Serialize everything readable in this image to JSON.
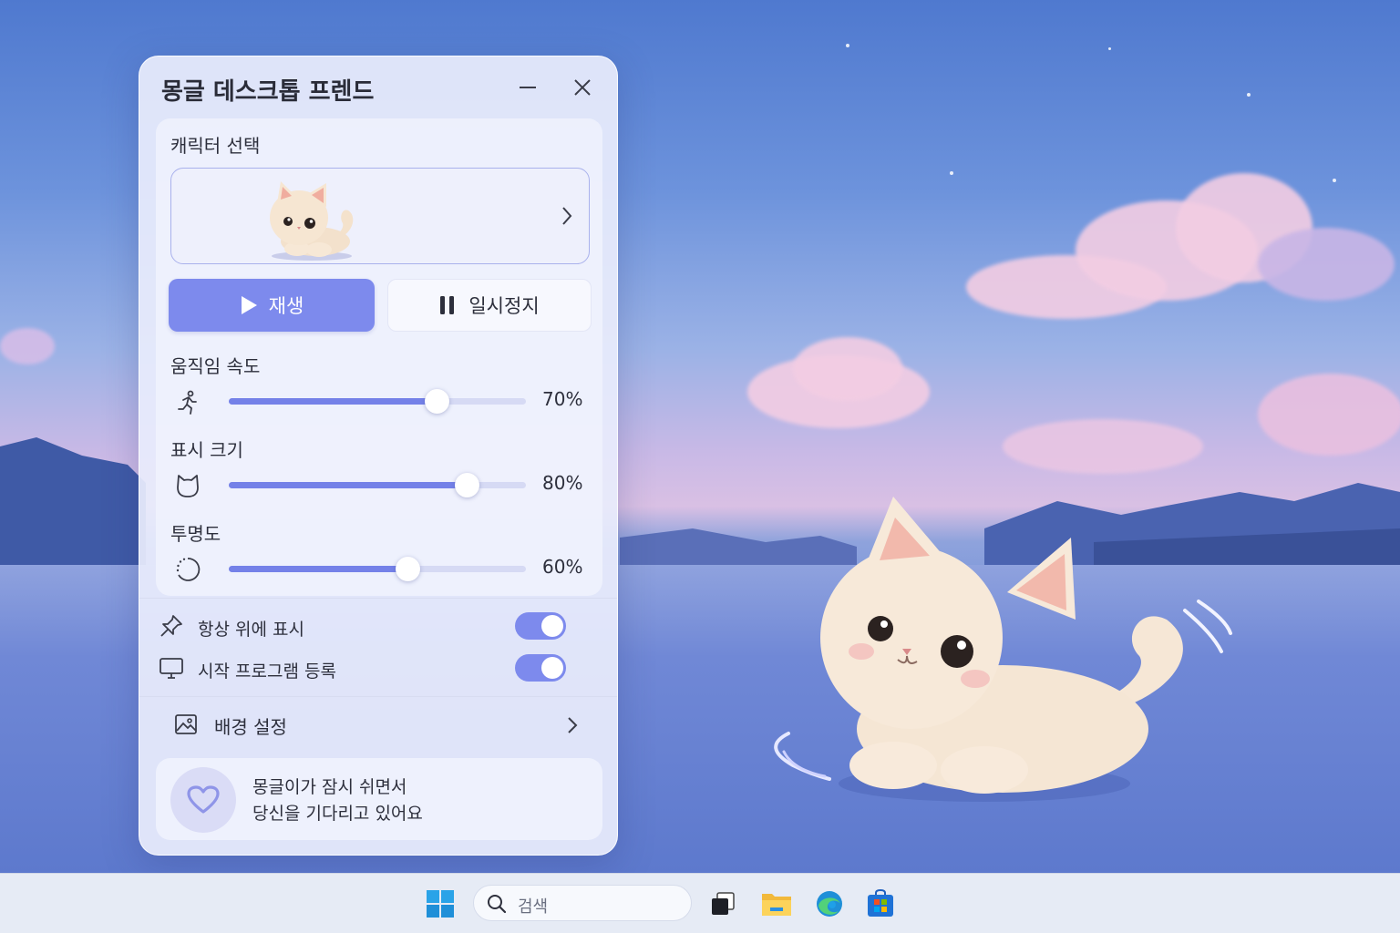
{
  "window": {
    "title": "몽글 데스크톱 프렌드",
    "minimize_icon": "minimize-icon",
    "close_icon": "close-icon"
  },
  "character": {
    "section_label": "캐릭터 선택",
    "selected_thumbnail": "cream-kitten",
    "chevron_icon": "chevron-right-icon"
  },
  "playback": {
    "play_label": "재생",
    "play_icon": "play-icon",
    "pause_label": "일시정지",
    "pause_icon": "pause-icon",
    "accent_color": "#7d8aed"
  },
  "sliders": {
    "speed": {
      "label": "움직임 속도",
      "value_text": "70%",
      "value": 0.7,
      "icon": "running-person-icon"
    },
    "size": {
      "label": "표시 크기",
      "value_text": "80%",
      "value": 0.8,
      "icon": "cat-face-icon"
    },
    "opacity": {
      "label": "투명도",
      "value_text": "60%",
      "value": 0.6,
      "icon": "dotted-circle-icon"
    }
  },
  "toggles": {
    "always_on_top": {
      "label": "항상 위에 표시",
      "on": true,
      "icon": "pin-icon"
    },
    "startup": {
      "label": "시작 프로그램 등록",
      "on": true,
      "icon": "monitor-icon"
    }
  },
  "background": {
    "label": "배경 설정",
    "icon": "image-icon"
  },
  "message": {
    "line1": "몽글이가 잠시 쉬면서",
    "line2": "당신을 기다리고 있어요",
    "icon": "heart-icon"
  },
  "taskbar": {
    "search_placeholder": "검색",
    "items": [
      "windows-start-icon",
      "search-icon",
      "task-view-icon",
      "file-explorer-icon",
      "edge-browser-icon",
      "store-icon"
    ]
  }
}
